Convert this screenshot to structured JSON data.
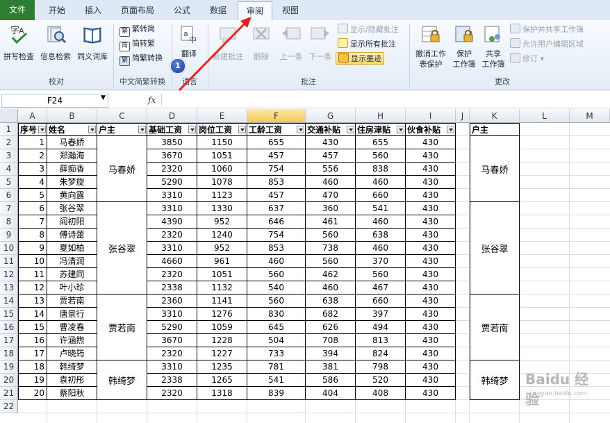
{
  "tabs": [
    "文件",
    "开始",
    "插入",
    "页面布局",
    "公式",
    "数据",
    "审阅",
    "视图"
  ],
  "active_tab": "审阅",
  "ribbon": {
    "proofing": {
      "spell": "拼写检查",
      "research": "信息检索",
      "thesaurus": "同义词库",
      "group": "校对"
    },
    "chinese": {
      "to_simplified": "繁转简",
      "to_traditional": "简转繁",
      "convert": "简繁转换",
      "group": "中文简繁转换"
    },
    "language": {
      "translate": "翻译",
      "group": "语言"
    },
    "comments": {
      "new": "新建批注",
      "delete": "删除",
      "prev": "上一条",
      "next": "下一条",
      "show_hide": "显示/隐藏批注",
      "show_all": "显示所有批注",
      "show_ink": "显示墨迹",
      "group": "批注"
    },
    "changes": {
      "unprotect_sheet_1": "撤消工作",
      "unprotect_sheet_2": "表保护",
      "protect_wb_1": "保护",
      "protect_wb_2": "工作簿",
      "share_wb_1": "共享",
      "share_wb_2": "工作簿",
      "protect_share": "保护并共享工作簿",
      "allow_edit": "允许用户编辑区域",
      "track": "修订",
      "group": "更改"
    }
  },
  "callout_number": "1",
  "name_box": "F24",
  "fx_label": "fx",
  "column_letters": [
    "A",
    "B",
    "C",
    "D",
    "E",
    "F",
    "G",
    "H",
    "I",
    "J",
    "K",
    "L",
    "M"
  ],
  "row_numbers": [
    "1",
    "2",
    "3",
    "4",
    "5",
    "6",
    "7",
    "8",
    "9",
    "10",
    "11",
    "12",
    "13",
    "14",
    "15",
    "16",
    "17",
    "18",
    "19",
    "20",
    "21",
    "22"
  ],
  "headers": [
    "序号",
    "姓名",
    "户主",
    "基础工资",
    "岗位工资",
    "工龄工资",
    "交通补贴",
    "住房津贴",
    "伙食补贴"
  ],
  "rows": [
    [
      "1",
      "马春娇",
      "3850",
      "1150",
      "655",
      "430",
      "655",
      "430"
    ],
    [
      "2",
      "郑瀚海",
      "3670",
      "1051",
      "457",
      "457",
      "560",
      "430"
    ],
    [
      "3",
      "薛痴香",
      "2320",
      "1060",
      "754",
      "556",
      "838",
      "430"
    ],
    [
      "4",
      "朱梦旋",
      "5290",
      "1078",
      "853",
      "460",
      "460",
      "430"
    ],
    [
      "5",
      "黄向露",
      "3310",
      "1123",
      "457",
      "470",
      "660",
      "430"
    ],
    [
      "6",
      "张谷翠",
      "3310",
      "1330",
      "637",
      "360",
      "541",
      "430"
    ],
    [
      "7",
      "阎初阳",
      "4390",
      "952",
      "646",
      "461",
      "460",
      "430"
    ],
    [
      "8",
      "傅诗蕾",
      "2320",
      "1240",
      "754",
      "560",
      "638",
      "430"
    ],
    [
      "9",
      "夏如柏",
      "3310",
      "952",
      "853",
      "738",
      "460",
      "430"
    ],
    [
      "10",
      "冯清润",
      "4660",
      "961",
      "460",
      "560",
      "370",
      "430"
    ],
    [
      "11",
      "苏建同",
      "2320",
      "1051",
      "560",
      "462",
      "560",
      "430"
    ],
    [
      "12",
      "叶小珍",
      "2338",
      "1132",
      "540",
      "460",
      "467",
      "430"
    ],
    [
      "13",
      "贾若南",
      "2360",
      "1141",
      "560",
      "638",
      "660",
      "430"
    ],
    [
      "14",
      "唐景行",
      "3310",
      "1276",
      "830",
      "682",
      "397",
      "430"
    ],
    [
      "15",
      "曹凌春",
      "5290",
      "1059",
      "645",
      "626",
      "494",
      "430"
    ],
    [
      "16",
      "许涵煦",
      "3670",
      "1228",
      "504",
      "708",
      "813",
      "430"
    ],
    [
      "17",
      "卢晓筠",
      "2320",
      "1227",
      "733",
      "394",
      "824",
      "430"
    ],
    [
      "18",
      "韩绮梦",
      "3310",
      "1235",
      "781",
      "381",
      "798",
      "430"
    ],
    [
      "19",
      "袁初彤",
      "2338",
      "1265",
      "541",
      "586",
      "520",
      "430"
    ],
    [
      "20",
      "蔡阳秋",
      "2320",
      "1318",
      "839",
      "404",
      "408",
      "430"
    ]
  ],
  "households": [
    "马春娇",
    "张谷翠",
    "贾若南",
    "韩绮梦"
  ],
  "k_header": "户主",
  "watermark": "Baidu 经验",
  "watermark_sub": "jingyan.baidu.com"
}
